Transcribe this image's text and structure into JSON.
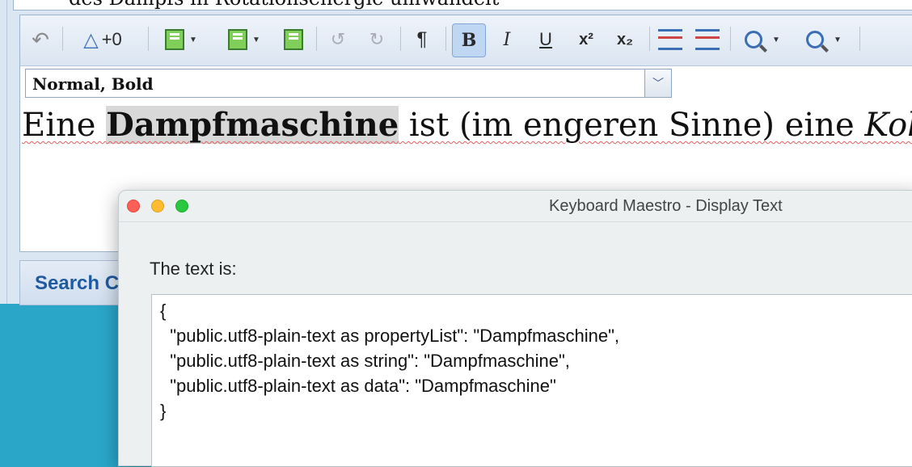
{
  "editor": {
    "previous_line": "des Dampfs in Rotationsenergie umwandelt",
    "toolbar": {
      "change_count": "+0",
      "paragraph": "¶",
      "bold": "B",
      "italic": "I",
      "underline": "U",
      "superscript": "x²",
      "subscript": "x₂"
    },
    "style_value": "Normal, Bold",
    "document": {
      "before": "Eine ",
      "selected": "Dampfmaschine",
      "middle": " ist (im engeren Sinne) eine ",
      "italic": "Kolb"
    },
    "search_label": "Search C"
  },
  "dialog": {
    "title": "Keyboard Maestro - Display Text",
    "prompt": "The text is:",
    "content": "{\n  \"public.utf8-plain-text as propertyList\": \"Dampfmaschine\",\n  \"public.utf8-plain-text as string\": \"Dampfmaschine\",\n  \"public.utf8-plain-text as data\": \"Dampfmaschine\"\n}"
  }
}
